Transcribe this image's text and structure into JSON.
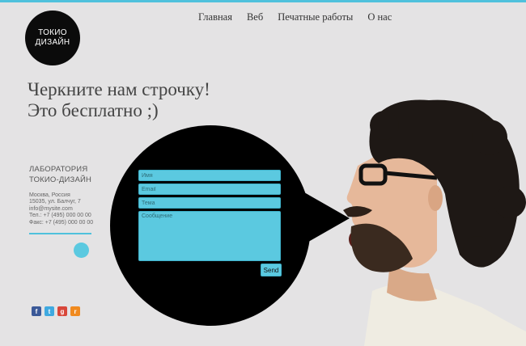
{
  "brand": {
    "line1": "ТОКИО",
    "line2": "ДИЗАЙН"
  },
  "nav": {
    "items": [
      {
        "label": "Главная"
      },
      {
        "label": "Веб"
      },
      {
        "label": "Печатные работы"
      },
      {
        "label": "О нас"
      }
    ]
  },
  "hero": {
    "line1": "Черкните нам строчку!",
    "line2": "Это бесплатно ;)"
  },
  "form": {
    "name_placeholder": "Имя",
    "email_placeholder": "Email",
    "subject_placeholder": "Тема",
    "message_placeholder": "Сообщение",
    "send_label": "Send"
  },
  "sidebar": {
    "title_line1": "ЛАБОРАТОРИЯ",
    "title_line2": "ТОКИО-ДИЗАЙН",
    "address_line1": "Москва, Россия",
    "address_line2": "15035, ул. Балчуг, 7",
    "email": "info@mysite.com",
    "phone": "Тел.: +7 (495) 000 00 00",
    "fax": "Факс: +7 (495) 000 00 00"
  },
  "social": {
    "icons": [
      {
        "name": "facebook-icon",
        "glyph": "f",
        "color": "#3b5998"
      },
      {
        "name": "twitter-icon",
        "glyph": "t",
        "color": "#3fa9e0"
      },
      {
        "name": "google-plus-icon",
        "glyph": "g",
        "color": "#d8473a"
      },
      {
        "name": "rss-icon",
        "glyph": "r",
        "color": "#f08a1f"
      }
    ]
  },
  "colors": {
    "accent": "#4fc1dc",
    "field": "#5bc9e0",
    "bubble": "#000000",
    "background": "#e4e3e4"
  }
}
